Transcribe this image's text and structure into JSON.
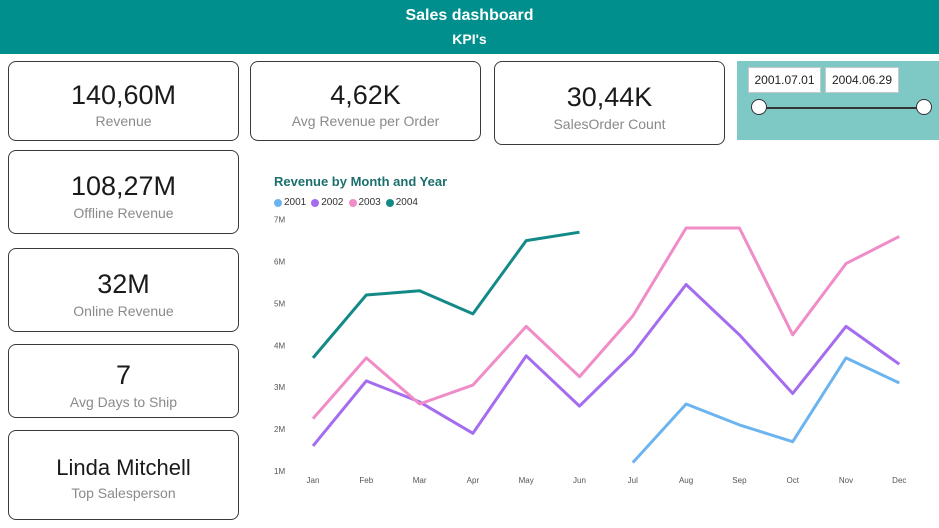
{
  "header": {
    "title": "Sales dashboard",
    "subtitle": "KPI's"
  },
  "kpis": {
    "revenue": {
      "value": "140,60M",
      "label": "Revenue"
    },
    "avg_revenue_order": {
      "value": "4,62K",
      "label": "Avg Revenue per Order"
    },
    "salesorder_count": {
      "value": "30,44K",
      "label": "SalesOrder Count"
    },
    "offline_revenue": {
      "value": "108,27M",
      "label": "Offline Revenue"
    },
    "online_revenue": {
      "value": "32M",
      "label": "Online Revenue"
    },
    "avg_days_ship": {
      "value": "7",
      "label": "Avg Days to Ship"
    },
    "top_salesperson": {
      "value": "Linda Mitchell",
      "label": "Top Salesperson"
    }
  },
  "slicer": {
    "start_date": "2001.07.01",
    "end_date": "2004.06.29"
  },
  "chart_data": {
    "type": "line",
    "title": "Revenue by Month and Year",
    "categories": [
      "Jan",
      "Feb",
      "Mar",
      "Apr",
      "May",
      "Jun",
      "Jul",
      "Aug",
      "Sep",
      "Oct",
      "Nov",
      "Dec"
    ],
    "y_ticks": [
      "1M",
      "2M",
      "3M",
      "4M",
      "5M",
      "6M",
      "7M"
    ],
    "ylim": [
      1,
      7
    ],
    "series": [
      {
        "name": "2001",
        "color": "#6cb4f0",
        "values": [
          null,
          null,
          null,
          null,
          null,
          null,
          1.2,
          2.6,
          2.1,
          1.7,
          3.7,
          3.1
        ]
      },
      {
        "name": "2002",
        "color": "#a66cf0",
        "values": [
          1.6,
          3.15,
          2.65,
          1.9,
          3.75,
          2.55,
          3.8,
          5.45,
          4.25,
          2.85,
          4.45,
          3.55
        ]
      },
      {
        "name": "2003",
        "color": "#f08cc8",
        "values": [
          2.25,
          3.7,
          2.6,
          3.05,
          4.45,
          3.25,
          4.7,
          6.8,
          6.8,
          4.25,
          5.95,
          6.6
        ]
      },
      {
        "name": "2004",
        "color": "#138a88",
        "values": [
          3.7,
          5.2,
          5.3,
          4.75,
          6.5,
          6.7,
          null,
          null,
          null,
          null,
          null,
          null
        ]
      }
    ]
  }
}
